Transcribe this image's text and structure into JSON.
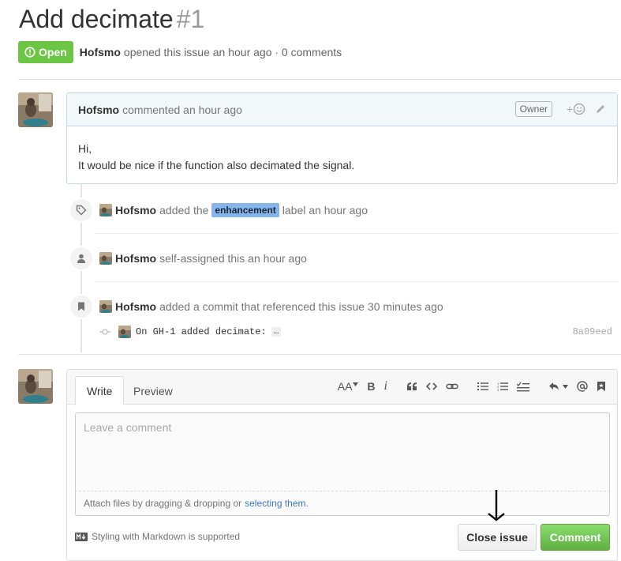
{
  "issue": {
    "title": "Add decimate",
    "number": "#1",
    "state": "Open",
    "author": "Hofsmo",
    "opened_text": "opened this issue an hour ago · 0 comments"
  },
  "comment": {
    "author": "Hofsmo",
    "time_text": "commented an hour ago",
    "owner_badge": "Owner",
    "reaction_label": "+",
    "body_line1": "Hi,",
    "body_line2": "It would be nice if the function also decimated the signal."
  },
  "events": [
    {
      "author": "Hofsmo",
      "pre": "added the",
      "label": "enhancement",
      "post": "label an hour ago",
      "icon": "tag-icon"
    },
    {
      "author": "Hofsmo",
      "text": "self-assigned this an hour ago",
      "icon": "person-icon"
    },
    {
      "author": "Hofsmo",
      "text": "added a commit that referenced this issue 30 minutes ago",
      "icon": "bookmark-icon"
    }
  ],
  "commit": {
    "message": "On GH-1 added decimate:",
    "ellipsis": "…",
    "sha": "8a09eed"
  },
  "editor": {
    "tabs": [
      "Write",
      "Preview"
    ],
    "placeholder": "Leave a comment",
    "attach_text": "Attach files by dragging & dropping or",
    "attach_link": "selecting them.",
    "markdown_note": "Styling with Markdown is supported",
    "close_button": "Close issue",
    "comment_button": "Comment",
    "toolbar_text": {
      "header": "AA",
      "bold": "B",
      "italic": "i"
    }
  },
  "colors": {
    "open_green": "#6cc644",
    "label_enhancement": "#84b6eb",
    "link": "#4078c0",
    "comment_button": "#60b044"
  }
}
